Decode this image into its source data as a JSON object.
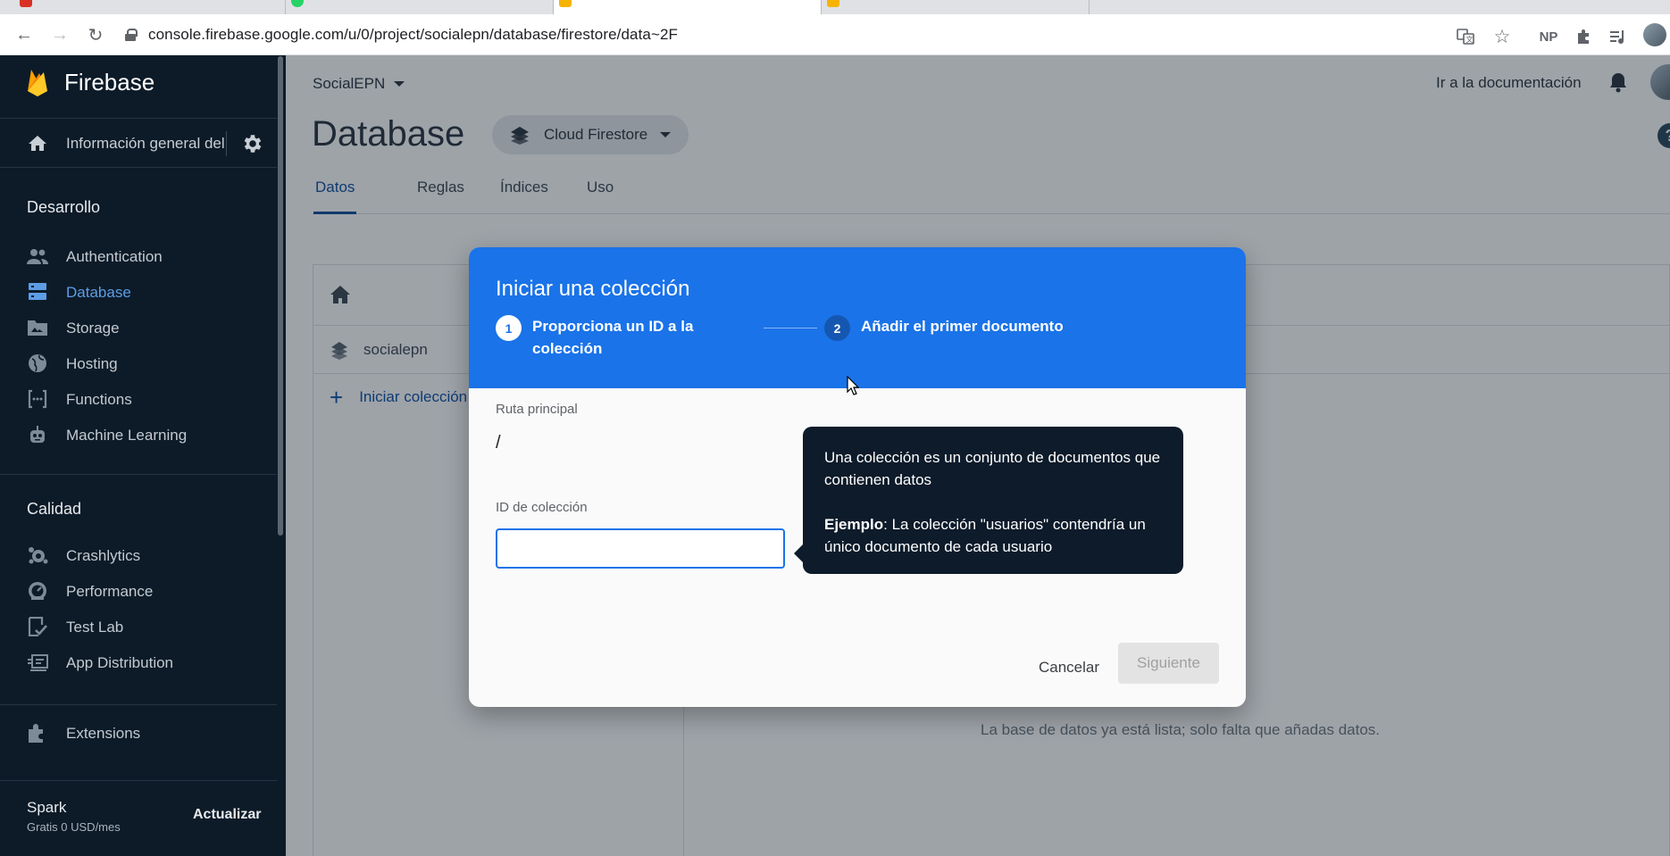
{
  "browser": {
    "url": "console.firebase.google.com/u/0/project/socialepn/database/firestore/data~2F",
    "extension_label": "NP"
  },
  "sidebar": {
    "brand": "Firebase",
    "overview": "Información general del proyecto",
    "sections": [
      {
        "title": "Desarrollo",
        "items": [
          {
            "label": "Authentication",
            "icon": "people-icon"
          },
          {
            "label": "Database",
            "icon": "database-icon",
            "active": true
          },
          {
            "label": "Storage",
            "icon": "folder-icon"
          },
          {
            "label": "Hosting",
            "icon": "globe-icon"
          },
          {
            "label": "Functions",
            "icon": "functions-icon"
          },
          {
            "label": "Machine Learning",
            "icon": "robot-icon"
          }
        ]
      },
      {
        "title": "Calidad",
        "items": [
          {
            "label": "Crashlytics",
            "icon": "crashlytics-icon"
          },
          {
            "label": "Performance",
            "icon": "speedometer-icon"
          },
          {
            "label": "Test Lab",
            "icon": "checklist-icon"
          },
          {
            "label": "App Distribution",
            "icon": "distribution-icon"
          }
        ]
      }
    ],
    "extensions": "Extensions",
    "plan": {
      "name": "Spark",
      "price": "Gratis 0 USD/mes",
      "upgrade": "Actualizar"
    }
  },
  "header": {
    "project": "SocialEPN",
    "docs_link": "Ir a la documentación",
    "page_title": "Database",
    "db_selector": "Cloud Firestore",
    "tabs": [
      "Datos",
      "Reglas",
      "Índices",
      "Uso"
    ],
    "active_tab": "Datos"
  },
  "data_panel": {
    "root": "socialepn",
    "start_collection": "Iniciar colección",
    "empty_message": "La base de datos ya está lista; solo falta que añadas datos."
  },
  "dialog": {
    "title": "Iniciar una colección",
    "steps": [
      {
        "number": "1",
        "label": "Proporciona un ID a la colección"
      },
      {
        "number": "2",
        "label": "Añadir el primer documento"
      }
    ],
    "parent_path_label": "Ruta principal",
    "parent_path_value": "/",
    "collection_id_label": "ID de colección",
    "collection_id_value": "",
    "tooltip": {
      "line1": "Una colección es un conjunto de documentos que contienen datos",
      "example_label": "Ejemplo",
      "example_text": ": La colección \"usuarios\" contendría un único documento de cada usuario"
    },
    "cancel": "Cancelar",
    "next": "Siguiente"
  },
  "colors": {
    "sidebar_bg": "#0d1b28",
    "primary": "#1a73e8",
    "active_nav": "#5d9de6",
    "overlay": "#9ea3a8"
  }
}
